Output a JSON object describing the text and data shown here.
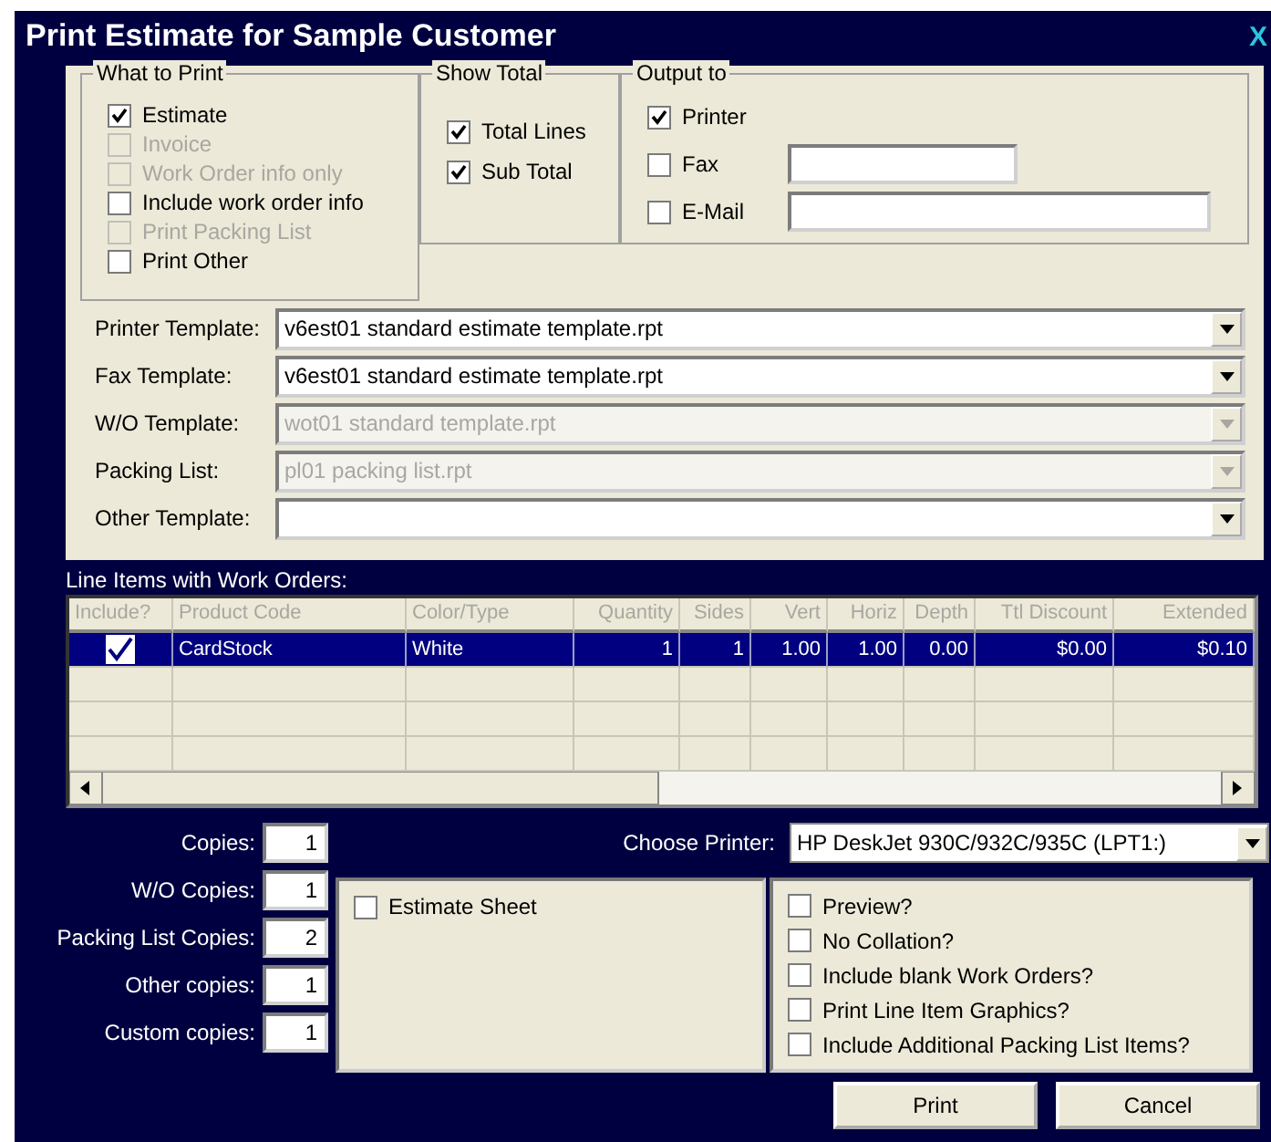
{
  "window": {
    "title": "Print Estimate for Sample Customer",
    "close": "X"
  },
  "what_to_print": {
    "title": "What to Print",
    "items": [
      {
        "label": "Estimate",
        "checked": true,
        "disabled": false
      },
      {
        "label": "Invoice",
        "checked": false,
        "disabled": true
      },
      {
        "label": "Work Order info only",
        "checked": false,
        "disabled": true
      },
      {
        "label": "Include work order info",
        "checked": false,
        "disabled": false
      },
      {
        "label": "Print Packing List",
        "checked": false,
        "disabled": true
      },
      {
        "label": "Print Other",
        "checked": false,
        "disabled": false
      }
    ]
  },
  "show_total": {
    "title": "Show Total",
    "items": [
      {
        "label": "Total Lines",
        "checked": true
      },
      {
        "label": "Sub Total",
        "checked": true
      }
    ]
  },
  "output_to": {
    "title": "Output to",
    "items": [
      {
        "label": "Printer",
        "checked": true,
        "has_field": false
      },
      {
        "label": "Fax",
        "checked": false,
        "has_field": true
      },
      {
        "label": "E-Mail",
        "checked": false,
        "has_field": true
      }
    ]
  },
  "templates": [
    {
      "label": "Printer Template:",
      "value": "v6est01 standard estimate template.rpt",
      "disabled": false
    },
    {
      "label": "Fax Template:",
      "value": "v6est01 standard estimate template.rpt",
      "disabled": false
    },
    {
      "label": "W/O Template:",
      "value": "wot01 standard template.rpt",
      "disabled": true
    },
    {
      "label": "Packing List:",
      "value": "pl01 packing list.rpt",
      "disabled": true
    },
    {
      "label": "Other Template:",
      "disabled": false
    }
  ],
  "line_items": {
    "title": "Line Items with Work Orders:",
    "include_column": "Include?",
    "columns": [
      "Product Code",
      "Color/Type",
      "Quantity",
      "Sides",
      "Vert",
      "Horiz",
      "Depth",
      "Ttl Discount",
      "Extended"
    ],
    "rows": [
      {
        "include": true,
        "selected": true,
        "cells": [
          "CardStock",
          "White",
          "1",
          "1",
          "1.00",
          "1.00",
          "0.00",
          "$0.00",
          "$0.10"
        ]
      }
    ]
  },
  "copies": [
    {
      "label": "Copies:",
      "value": "1"
    },
    {
      "label": "W/O Copies:",
      "value": "1"
    },
    {
      "label": "Packing List Copies:",
      "value": "2"
    },
    {
      "label": "Other copies:",
      "value": "1"
    },
    {
      "label": "Custom copies:",
      "value": "1"
    }
  ],
  "printer": {
    "label": "Choose Printer:",
    "value": "HP DeskJet 930C/932C/935C (LPT1:)"
  },
  "sheets": [
    {
      "label": "Estimate Sheet",
      "checked": false
    }
  ],
  "options": [
    {
      "label": "Preview?",
      "checked": false
    },
    {
      "label": "No Collation?",
      "checked": false
    },
    {
      "label": "Include blank Work Orders?",
      "checked": false
    },
    {
      "label": "Print Line Item Graphics?",
      "checked": false
    },
    {
      "label": "Include Additional Packing List Items?",
      "checked": false
    }
  ],
  "buttons": [
    "Print",
    "Cancel"
  ]
}
